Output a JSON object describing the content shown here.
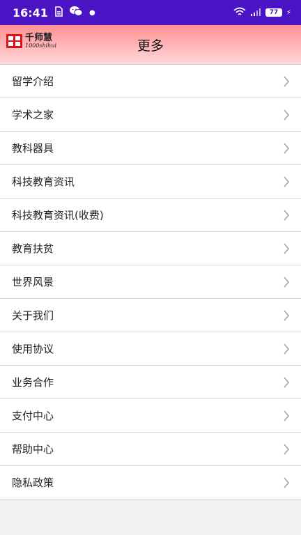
{
  "status_bar": {
    "time": "16:41",
    "battery": "77",
    "icons": [
      "sim-icon",
      "wechat-icon",
      "notification-dot-icon",
      "wifi-icon",
      "signal-icon",
      "battery-icon",
      "charging-icon"
    ]
  },
  "header": {
    "logo_cn": "千师慧",
    "logo_en": "1000shihui",
    "title": "更多"
  },
  "menu": {
    "items": [
      {
        "label": "留学介绍"
      },
      {
        "label": "学术之家"
      },
      {
        "label": "教科器具"
      },
      {
        "label": "科技教育资讯"
      },
      {
        "label": "科技教育资讯(收费)"
      },
      {
        "label": "教育扶贫"
      },
      {
        "label": "世界风景"
      },
      {
        "label": "关于我们"
      },
      {
        "label": "使用协议"
      },
      {
        "label": "业务合作"
      },
      {
        "label": "支付中心"
      },
      {
        "label": "帮助中心"
      },
      {
        "label": "隐私政策"
      }
    ]
  },
  "colors": {
    "status_bar": "#4a14c4",
    "header_top": "#ff8f93",
    "header_bottom": "#ffd9da",
    "logo_red": "#d8141a"
  }
}
